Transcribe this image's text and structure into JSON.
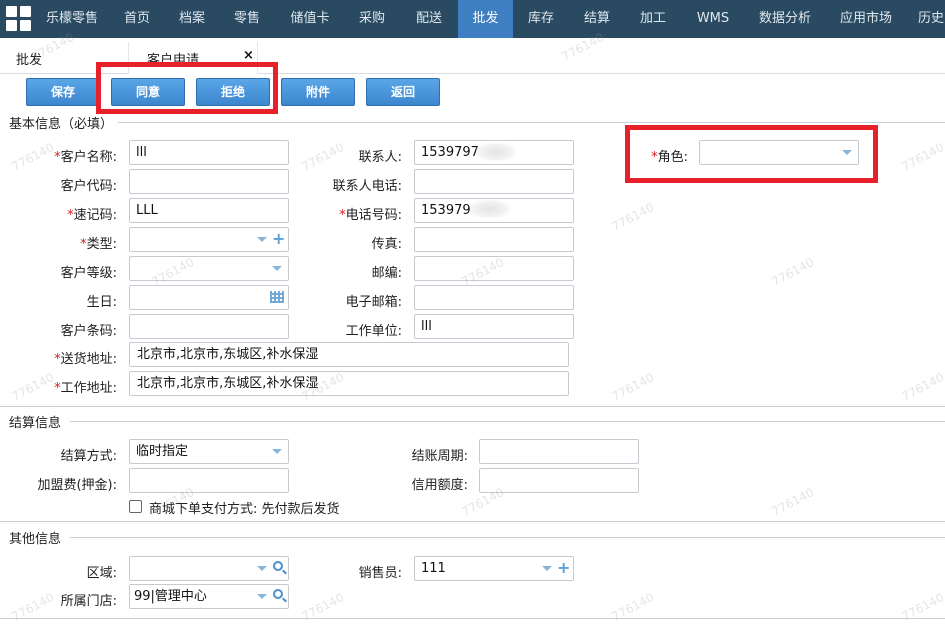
{
  "nav": {
    "brand": "乐檬零售",
    "items": [
      "首页",
      "档案",
      "零售",
      "储值卡",
      "采购",
      "配送",
      "批发",
      "库存",
      "结算",
      "加工",
      "WMS",
      "数据分析",
      "应用市场",
      "历史"
    ],
    "active": "批发"
  },
  "tabs": {
    "first": "批发",
    "second": "客户申请",
    "close": "×"
  },
  "toolbar": {
    "save": "保存",
    "agree": "同意",
    "reject": "拒绝",
    "attach": "附件",
    "back": "返回"
  },
  "basic": {
    "title": "基本信息（必填）",
    "labels": {
      "customer_name": "客户名称:",
      "customer_code": "客户代码:",
      "quick_code": "速记码:",
      "type": "类型:",
      "level": "客户等级:",
      "birthday": "生日:",
      "barcode": "客户条码:",
      "delivery_addr": "送货地址:",
      "work_addr": "工作地址:",
      "contact": "联系人:",
      "contact_phone": "联系人电话:",
      "tel": "电话号码:",
      "fax": "传真:",
      "zip": "邮编:",
      "email": "电子邮箱:",
      "work_unit": "工作单位:",
      "role": "角色:"
    },
    "values": {
      "customer_name": "lll",
      "quick_code": "LLL",
      "contact": "1539797",
      "tel": "153979",
      "work_unit": "lll",
      "delivery_addr": "北京市,北京市,东城区,补水保湿",
      "work_addr": "北京市,北京市,东城区,补水保湿"
    }
  },
  "settle": {
    "title": "结算信息",
    "labels": {
      "method": "结算方式:",
      "period": "结账周期:",
      "fee": "加盟费(押金):",
      "credit": "信用额度:"
    },
    "values": {
      "method": "临时指定"
    },
    "checkbox_label": "商城下单支付方式: 先付款后发货"
  },
  "other": {
    "title": "其他信息",
    "labels": {
      "area": "区域:",
      "store": "所属门店:",
      "sales": "销售员:"
    },
    "values": {
      "store": "99|管理中心",
      "sales": "111"
    }
  },
  "watermark": "776140",
  "colors": {
    "nav_bg": "#2a4a62",
    "nav_active": "#3d7fc1",
    "button": "#4a93d8",
    "highlight": "#e8202a",
    "required": "#d41b1b"
  }
}
